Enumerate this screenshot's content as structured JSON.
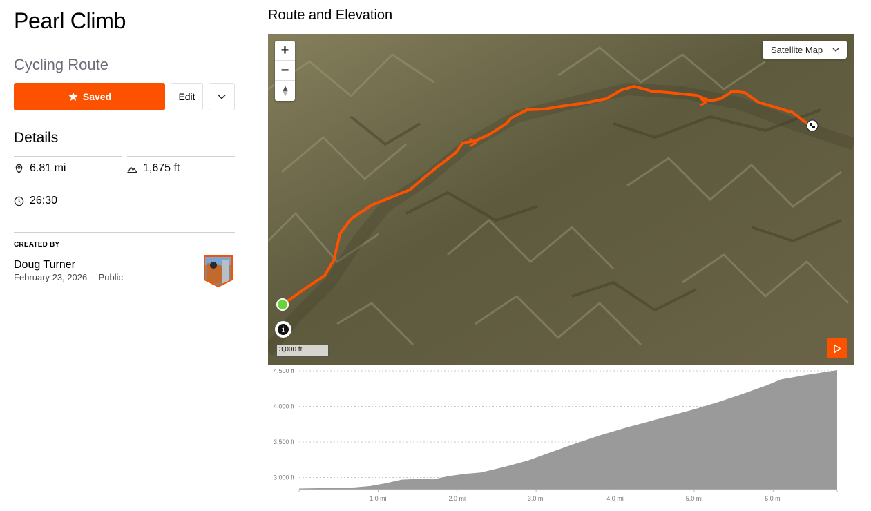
{
  "route": {
    "title": "Pearl Climb",
    "type": "Cycling Route",
    "saved_label": "Saved",
    "edit_label": "Edit"
  },
  "details": {
    "heading": "Details",
    "distance": "6.81 mi",
    "elevation_gain": "1,675 ft",
    "time": "26:30"
  },
  "creator": {
    "label": "CREATED BY",
    "name": "Doug Turner",
    "date": "February 23, 2026",
    "visibility": "Public"
  },
  "map": {
    "section_title": "Route and Elevation",
    "map_type": "Satellite Map",
    "scale_label": "3,000 ft",
    "accent_color": "#fc5200",
    "start_color": "#6bd13c"
  },
  "chart_data": {
    "type": "area",
    "xlabel": "",
    "ylabel": "",
    "x_ticks": [
      "1.0 mi",
      "2.0 mi",
      "3.0 mi",
      "4.0 mi",
      "5.0 mi",
      "6.0 mi"
    ],
    "y_ticks": [
      "4,500 ft",
      "4,000 ft",
      "3,500 ft",
      "3,000 ft"
    ],
    "ylim": [
      2830,
      4520
    ],
    "xlim": [
      0,
      6.81
    ],
    "x": [
      0,
      0.3,
      0.7,
      0.9,
      1.1,
      1.3,
      1.5,
      1.7,
      1.9,
      2.1,
      2.3,
      2.6,
      2.9,
      3.2,
      3.5,
      3.8,
      4.1,
      4.4,
      4.7,
      5.0,
      5.3,
      5.6,
      5.9,
      6.1,
      6.4,
      6.81
    ],
    "y": [
      2845,
      2850,
      2860,
      2880,
      2920,
      2970,
      2980,
      2975,
      3020,
      3050,
      3070,
      3150,
      3240,
      3360,
      3480,
      3590,
      3690,
      3780,
      3870,
      3960,
      4060,
      4170,
      4290,
      4380,
      4440,
      4510
    ]
  }
}
